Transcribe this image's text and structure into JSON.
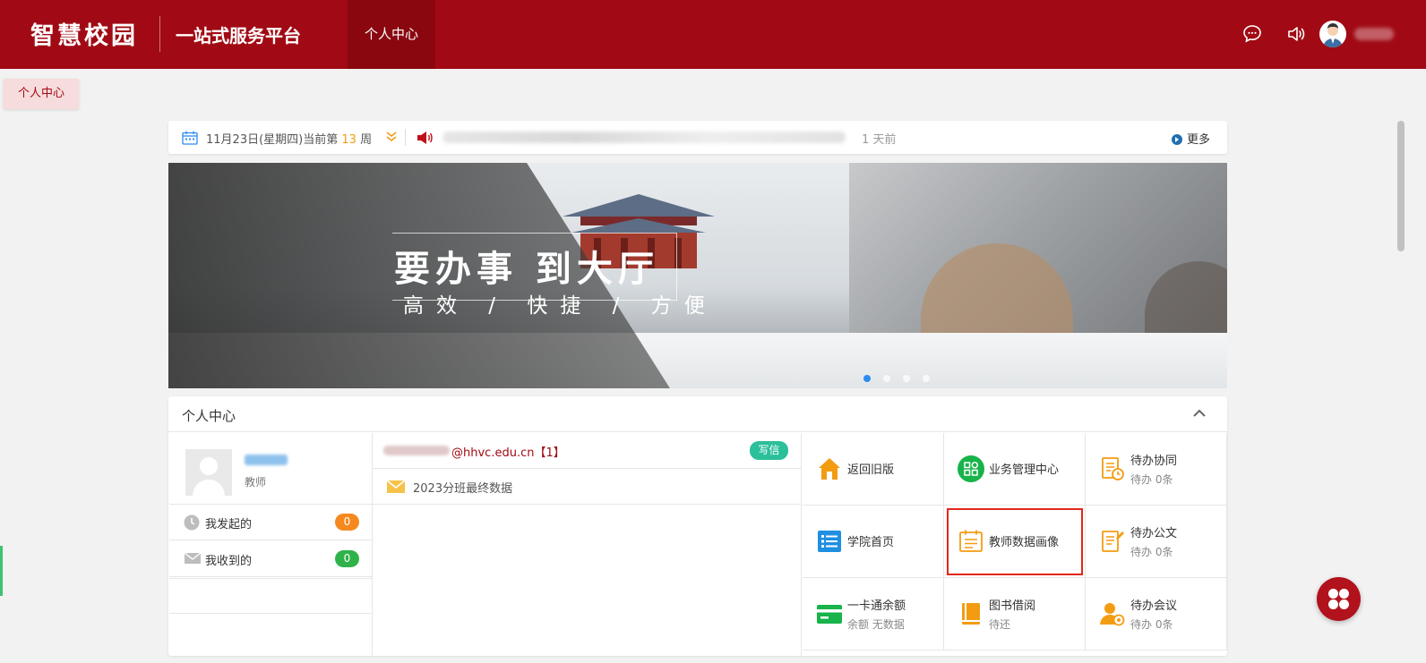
{
  "header": {
    "logo": "智慧校园",
    "platform": "一站式服务平台",
    "nav_active": "个人中心",
    "icons": [
      "chat-icon",
      "speaker-icon",
      "avatar"
    ]
  },
  "tag": {
    "label": "个人中心"
  },
  "notice": {
    "date": "11月23日(星期四)当前第",
    "week": "13",
    "week_unit": "周",
    "time_ago": "1 天前",
    "more": "更多"
  },
  "banner": {
    "headline": "要办事 到大厅",
    "subline": "高效 / 快捷 / 方便"
  },
  "panel": {
    "title": "个人中心",
    "profile": {
      "role": "教师"
    },
    "my_started": {
      "label": "我发起的",
      "count": "0"
    },
    "my_received": {
      "label": "我收到的",
      "count": "0"
    },
    "mail": {
      "account": "@hhvc.edu.cn【1】",
      "write": "写信",
      "subject": "2023分班最终数据"
    },
    "services": [
      {
        "label": "返回旧版",
        "sub": ""
      },
      {
        "label": "业务管理中心",
        "sub": ""
      },
      {
        "label": "待办协同",
        "sub": "待办  0条"
      },
      {
        "label": "学院首页",
        "sub": ""
      },
      {
        "label": "教师数据画像",
        "sub": ""
      },
      {
        "label": "待办公文",
        "sub": "待办  0条"
      },
      {
        "label": "一卡通余额",
        "sub": "余额  无数据"
      },
      {
        "label": "图书借阅",
        "sub": "待还"
      },
      {
        "label": "待办会议",
        "sub": "待办  0条"
      }
    ]
  },
  "colors": {
    "brand": "#a10a14",
    "badge_orange": "#f5891f",
    "badge_green": "#2fb24a",
    "highlight": "#e3261c"
  }
}
